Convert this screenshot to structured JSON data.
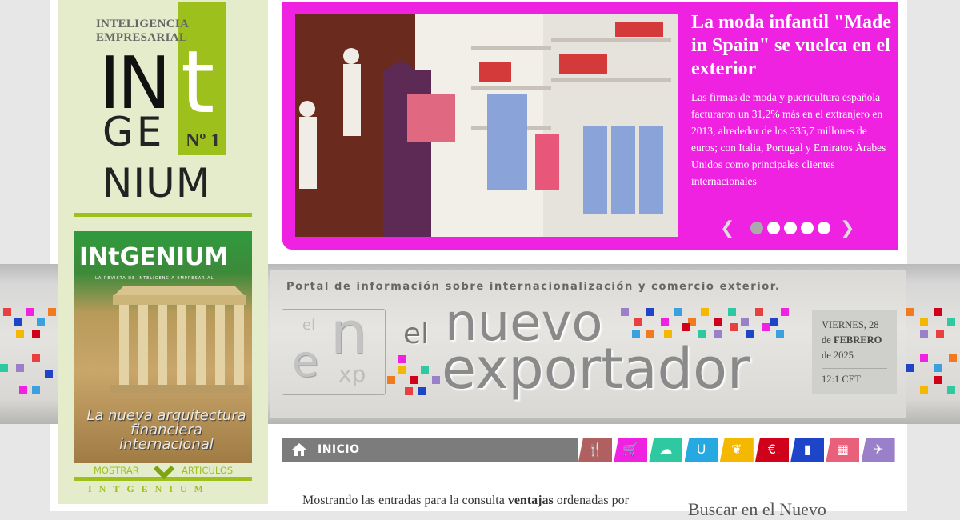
{
  "left_logo": {
    "line1": "INTELIGENCIA",
    "line2": "EMPRESARIAL",
    "big_in": "IN",
    "big_t": "t",
    "big_ge": "GE",
    "big_nium": "NIUM",
    "issue": "Nº 1"
  },
  "cover": {
    "title": "INtGENIUM",
    "subtitle": "LA REVISTA DE INTELIGENCIA EMPRESARIAL",
    "caption": "La nueva arquitectura financiera internacional",
    "show_label": "MOSTRAR",
    "articles_label": "ARTICULOS",
    "footer": "INTGENIUM"
  },
  "hero": {
    "title": "La moda infantil \"Made in Spain\" se vuelca en el exterior",
    "text": "Las firmas de moda y puericultura española facturaron un 31,2% más en el extranjero en 2013, alrededor de los 335,7 millones de euros; con Italia, Portugal y Emiratos Árabes Unidos como principales clientes internacionales",
    "prev": "❮",
    "next": "❯",
    "slides_total": 5,
    "slide_active": 1,
    "bg_color": "#ef22e1"
  },
  "banner": {
    "tagline": "Portal de información sobre internacionalización y comercio exterior.",
    "logo_el": "el",
    "logo_n": "n",
    "logo_e": "e",
    "logo_xp": "xp",
    "brand_el": "el",
    "brand_nuevo": "nuevo",
    "brand_exportador": "exportador"
  },
  "date": {
    "weekday": "VIERNES, 28",
    "de1": "de",
    "month": "FEBRERO",
    "year": "de 2025",
    "time": "12:1 CET"
  },
  "nav": {
    "home_label": "INICIO",
    "icons": [
      {
        "name": "restaurant-icon",
        "glyph": "🍴",
        "color": "#b06060"
      },
      {
        "name": "cart-icon",
        "glyph": "🛒",
        "color": "#ef22e1"
      },
      {
        "name": "cloud-icon",
        "glyph": "☁",
        "color": "#2ec9a0"
      },
      {
        "name": "magnet-icon",
        "glyph": "U",
        "color": "#25a9e0"
      },
      {
        "name": "leaf-icon",
        "glyph": "❦",
        "color": "#f5b800"
      },
      {
        "name": "euro-icon",
        "glyph": "€",
        "color": "#d0021b"
      },
      {
        "name": "book-icon",
        "glyph": "▮",
        "color": "#1e44c8"
      },
      {
        "name": "film-icon",
        "glyph": "▦",
        "color": "#e8607a"
      },
      {
        "name": "plane-icon",
        "glyph": "✈",
        "color": "#9a80c9"
      }
    ]
  },
  "content": {
    "text_prefix": "Mostrando las entradas para la consulta ",
    "query": "ventajas",
    "text_suffix": " ordenadas por",
    "search_title": "Buscar en el Nuevo"
  }
}
